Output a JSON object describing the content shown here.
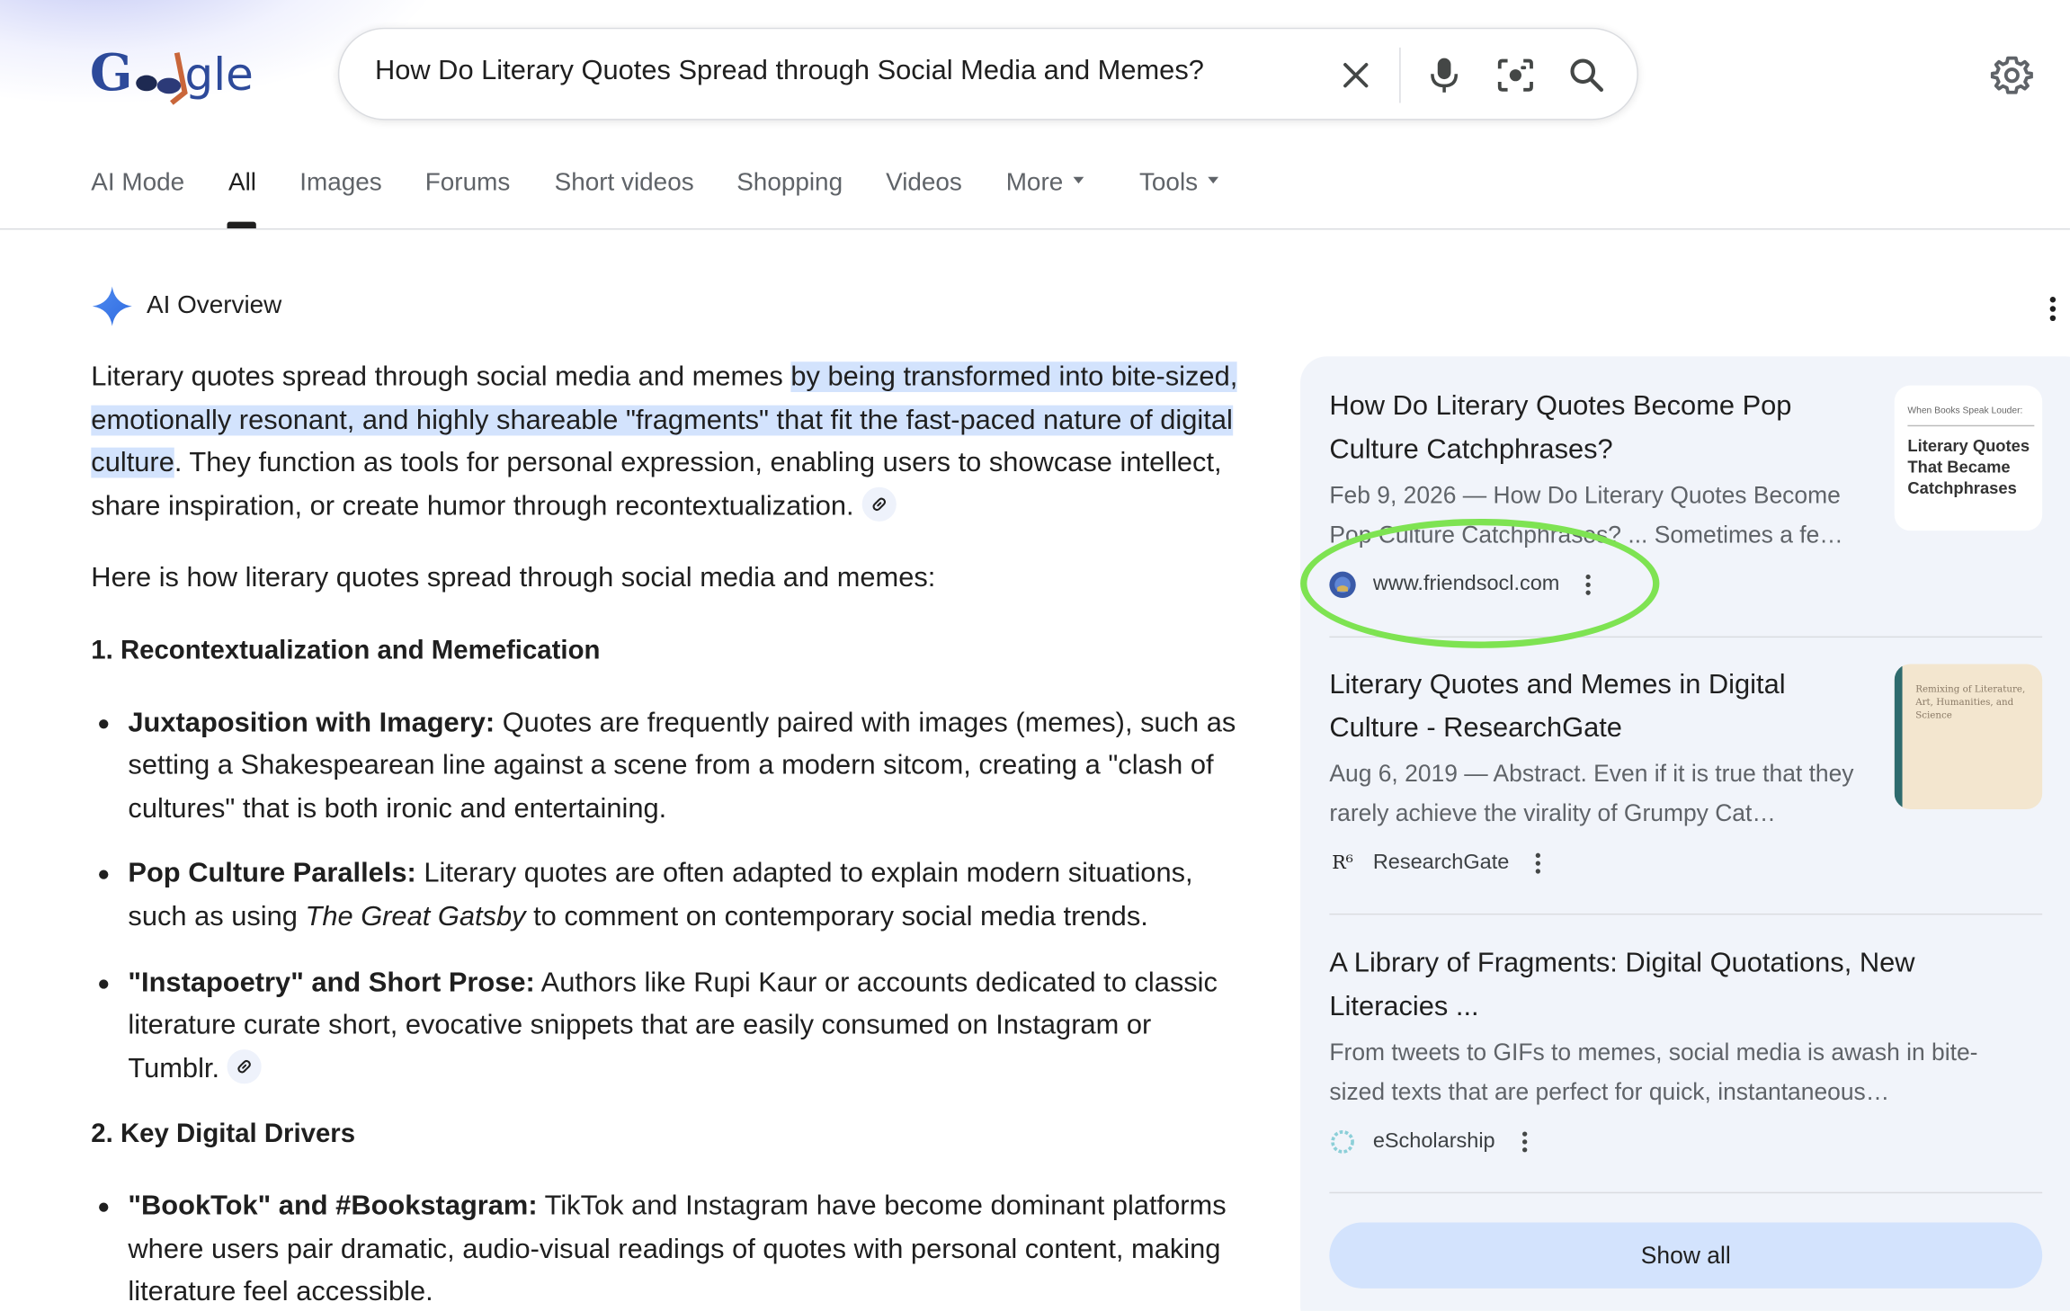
{
  "header": {
    "logo_text": "Google",
    "search_query": "How Do Literary Quotes Spread through Social Media and Memes?",
    "icons": [
      "clear-icon",
      "microphone-icon",
      "lens-camera-icon",
      "search-icon",
      "settings-gear-icon"
    ]
  },
  "tabs": [
    {
      "label": "AI Mode"
    },
    {
      "label": "All",
      "active": true
    },
    {
      "label": "Images"
    },
    {
      "label": "Forums"
    },
    {
      "label": "Short videos"
    },
    {
      "label": "Shopping"
    },
    {
      "label": "Videos"
    },
    {
      "label": "More"
    },
    {
      "label": "Tools"
    }
  ],
  "overview": {
    "title": "AI Overview",
    "intro_before": "Literary quotes spread through social media and memes ",
    "intro_highlight": "by being transformed into bite-sized, emotionally resonant, and highly shareable \"fragments\" that fit the fast-paced nature of digital culture",
    "intro_after": ". They function as tools for personal expression, enabling users to showcase intellect, share inspiration, or create humor through recontextualization.",
    "lead": "Here is how literary quotes spread through social media and memes:",
    "section1": {
      "heading": "1. Recontextualization and Memefication",
      "items": [
        {
          "bold": "Juxtaposition with Imagery:",
          "text": " Quotes are frequently paired with images (memes), such as setting a Shakespearean line against a scene from a modern sitcom, creating a \"clash of cultures\" that is both ironic and entertaining."
        },
        {
          "bold": "Pop Culture Parallels:",
          "text_before": " Literary quotes are often adapted to explain modern situations, such as using ",
          "italic": "The Great Gatsby",
          "text_after": " to comment on contemporary social media trends."
        },
        {
          "bold": "\"Instapoetry\" and Short Prose:",
          "text": " Authors like Rupi Kaur or accounts dedicated to classic literature curate short, evocative snippets that are easily consumed on Instagram or Tumblr."
        }
      ]
    },
    "section2": {
      "heading": "2. Key Digital Drivers",
      "items": [
        {
          "bold": "\"BookTok\" and #Bookstagram:",
          "text": " TikTok and Instagram have become dominant platforms where users pair dramatic, audio-visual readings of quotes with personal content, making literature feel accessible."
        }
      ]
    }
  },
  "sources": {
    "cards": [
      {
        "title": "How Do Literary Quotes Become Pop Culture Catchphrases?",
        "snippet": "Feb 9, 2026 — How Do Literary Quotes Become Pop Culture Catchphrases? ... Sometimes a fe…",
        "site": "www.friendsocl.com",
        "thumb_top": "When Books Speak Louder:",
        "thumb_main": "Literary Quotes That Became Catchphrases"
      },
      {
        "title": "Literary Quotes and Memes in Digital Culture - ResearchGate",
        "snippet": "Aug 6, 2019 — Abstract. Even if it is true that they rarely achieve the virality of Grumpy Cat…",
        "site": "ResearchGate",
        "site_icon_text": "R⁶",
        "thumb_text": "Remixing of Literature, Art, Humanities, and Science"
      },
      {
        "title": "A Library of Fragments: Digital Quotations, New Literacies ...",
        "snippet": "From tweets to GIFs to memes, social media is awash in bite-sized texts that are perfect for quick, instantaneous…",
        "site": "eScholarship"
      }
    ],
    "show_all_label": "Show all"
  },
  "colors": {
    "accent_blue": "#1a73e8",
    "highlight": "#d3e3fd",
    "panel_bg": "#f1f4fa",
    "annotation_ring": "#7ee352"
  }
}
